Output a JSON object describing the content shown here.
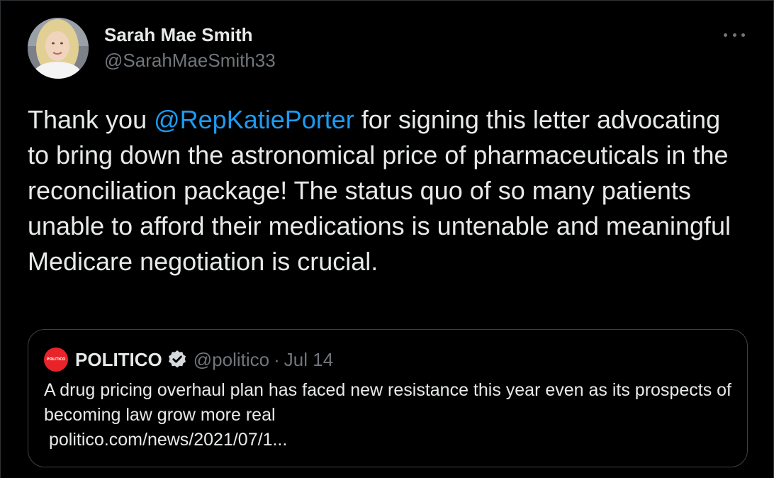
{
  "author": {
    "display_name": "Sarah Mae Smith",
    "handle": "@SarahMaeSmith33"
  },
  "more_icon": "more-horizontal-icon",
  "tweet": {
    "text_before": "Thank you ",
    "mention": "@RepKatiePorter",
    "text_after": " for signing this letter advocating to bring down the astronomical price of pharmaceuticals in the reconciliation package!  The status quo of so many patients unable to afford their medications is untenable and meaningful Medicare negotiation is crucial."
  },
  "quote": {
    "logo_text": "POLITICO",
    "name": "POLITICO",
    "verified_icon": "verified-badge-icon",
    "handle": "@politico",
    "separator": "·",
    "date": "Jul 14",
    "text": "A drug pricing overhaul plan has faced new resistance this year even as its prospects of becoming law grow more real",
    "link": "politico.com/news/2021/07/1..."
  },
  "colors": {
    "background": "#000000",
    "text": "#e7e9ea",
    "secondary": "#71767b",
    "link": "#1d9bf0",
    "politico_red": "#e8232a"
  }
}
